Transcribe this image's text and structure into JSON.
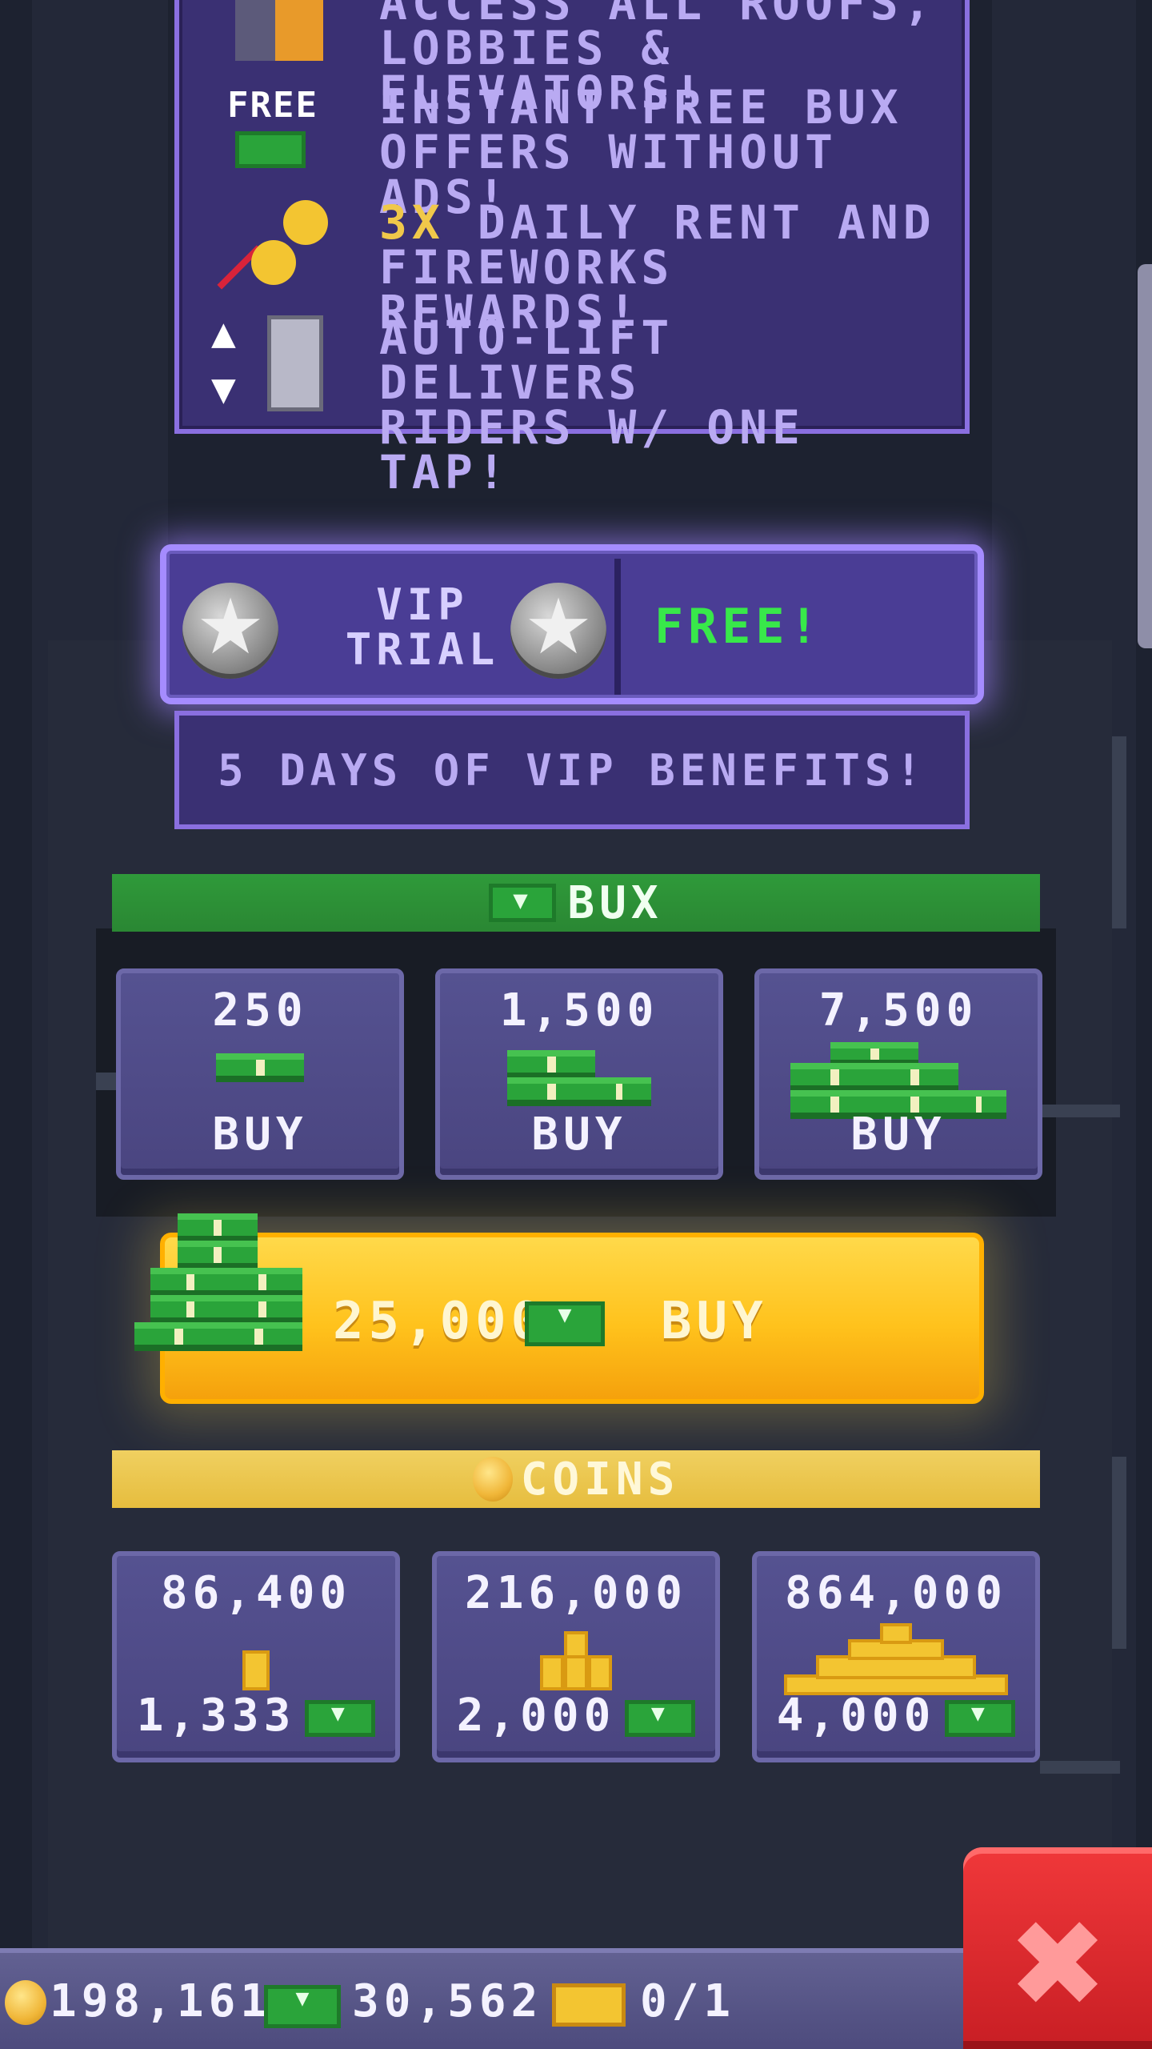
{
  "benefits": [
    {
      "icon": "vip-guest-icon",
      "line1": "ACCESS ALL ROOFS,",
      "line2": "LOBBIES & ELEVATORS!"
    },
    {
      "icon": "free-bux-icon",
      "icon_label": "FREE",
      "line1": "INSTANT FREE BUX",
      "line2": "OFFERS WITHOUT ADS!"
    },
    {
      "icon": "fireworks-coins-icon",
      "highlight": "3X",
      "line1": " DAILY RENT AND",
      "line2": "FIREWORKS REWARDS!"
    },
    {
      "icon": "elevator-icon",
      "line1": "AUTO-LIFT DELIVERS",
      "line2": "RIDERS W/ ONE TAP!"
    }
  ],
  "vip": {
    "label_line1": "VIP",
    "label_line2": "TRIAL",
    "price": "FREE!",
    "subtitle": "5 DAYS OF VIP BENEFITS!"
  },
  "bux_section": {
    "title": "BUX",
    "packs": [
      {
        "amount": "250",
        "buy": "BUY"
      },
      {
        "amount": "1,500",
        "buy": "BUY"
      },
      {
        "amount": "7,500",
        "buy": "BUY"
      }
    ],
    "big_offer": {
      "amount": "25,000",
      "buy": "BUY"
    }
  },
  "coins_section": {
    "title": "COINS",
    "packs": [
      {
        "amount": "86,400",
        "price": "1,333"
      },
      {
        "amount": "216,000",
        "price": "2,000"
      },
      {
        "amount": "864,000",
        "price": "4,000"
      }
    ]
  },
  "status_bar": {
    "coins": "198,161",
    "bux": "30,562",
    "tickets": "0/1"
  },
  "colors": {
    "panel": "#3a3073",
    "panel_border": "#8a6fe0",
    "bux_green": "#2f9a3a",
    "coins_gold": "#f0d060",
    "free_green": "#38e84a",
    "highlight_gold": "#f0c84a",
    "close_red": "#e02a30"
  }
}
